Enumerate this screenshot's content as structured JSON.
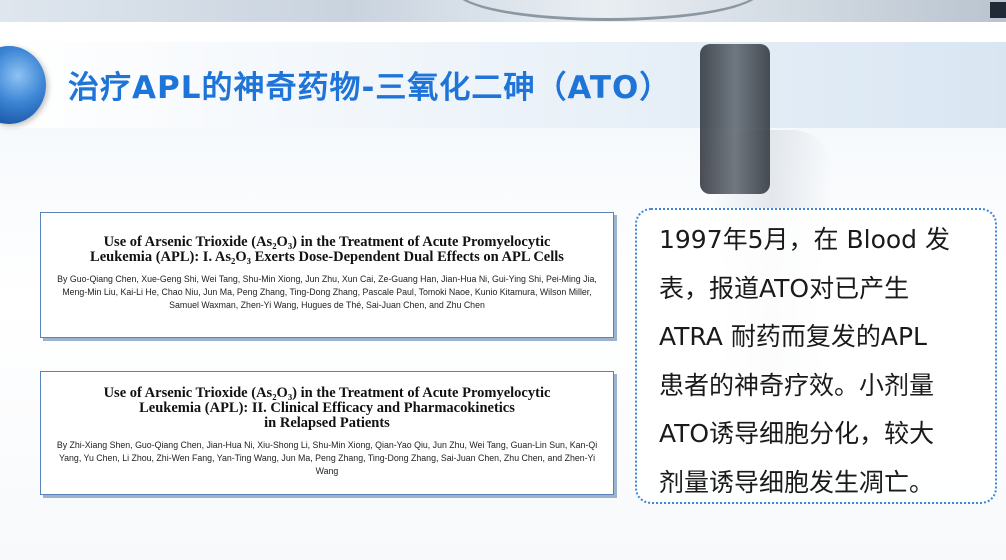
{
  "slide": {
    "title": "治疗APL的神奇药物-三氧化二砷（ATO）"
  },
  "papers": [
    {
      "title_line1": "Use of Arsenic Trioxide (As₂O₃) in the Treatment of Acute Promyelocytic",
      "title_line2": "Leukemia (APL): I. As₂O₃ Exerts Dose-Dependent Dual Effects on APL Cells",
      "title_line3": "",
      "authors": "By Guo-Qiang Chen, Xue-Geng Shi, Wei Tang, Shu-Min Xiong, Jun Zhu, Xun Cai, Ze-Guang Han, Jian-Hua Ni, Gui-Ying Shi, Pei-Ming Jia, Meng-Min Liu, Kai-Li He, Chao Niu, Jun Ma, Peng Zhang, Ting-Dong Zhang, Pascale Paul, Tomoki Naoe, Kunio Kitamura, Wilson Miller, Samuel Waxman, Zhen-Yi Wang, Hugues de Thé, Sai-Juan Chen, and Zhu Chen"
    },
    {
      "title_line1": "Use of Arsenic Trioxide (As₂O₃) in the Treatment of Acute Promyelocytic",
      "title_line2": "Leukemia (APL): II. Clinical Efficacy and Pharmacokinetics",
      "title_line3": "in Relapsed Patients",
      "authors": "By Zhi-Xiang Shen, Guo-Qiang Chen, Jian-Hua Ni, Xiu-Shong Li, Shu-Min Xiong, Qian-Yao Qiu, Jun Zhu, Wei Tang, Guan-Lin Sun, Kan-Qi Yang, Yu Chen, Li Zhou, Zhi-Wen Fang, Yan-Ting Wang, Jun Ma, Peng Zhang, Ting-Dong Zhang, Sai-Juan Chen, Zhu Chen, and Zhen-Yi Wang"
    }
  ],
  "note": {
    "lines": [
      "1997年5月，在 Blood 发",
      "表，报道ATO对已产生",
      "ATRA 耐药而复发的APL",
      "患者的神奇疗效。小剂量",
      "ATO诱导细胞分化，较大",
      "剂量诱导细胞发生凋亡。"
    ]
  },
  "colors": {
    "title": "#1f74d8",
    "accent_border": "#3d86d6",
    "card_border": "#5a83b8"
  }
}
